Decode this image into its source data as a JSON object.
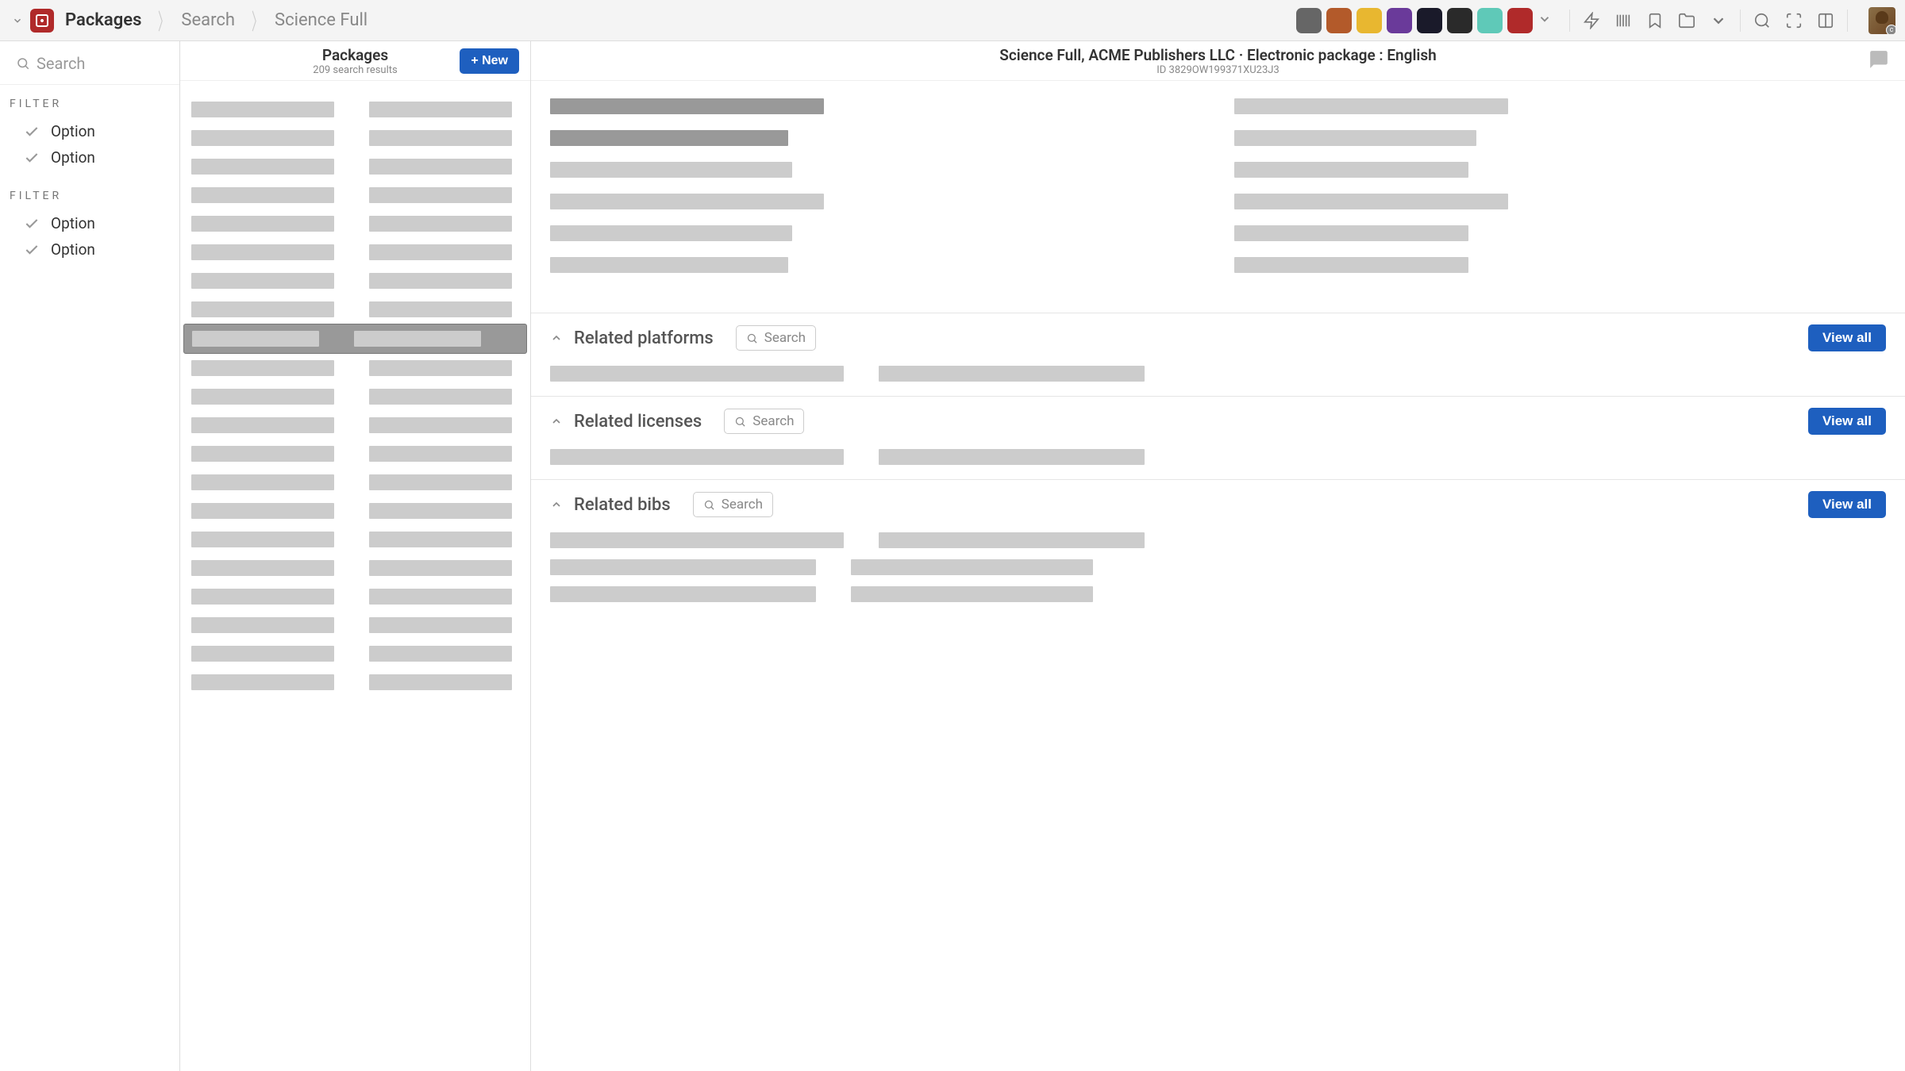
{
  "breadcrumbs": {
    "app_name": "Packages",
    "items": [
      "Search",
      "Science Full"
    ]
  },
  "top_tiles": [
    {
      "bg": "#666"
    },
    {
      "bg": "#b35a2a"
    },
    {
      "bg": "#e8b730"
    },
    {
      "bg": "#6a3a9a"
    },
    {
      "bg": "#1a1a2a"
    },
    {
      "bg": "#2a2a2a"
    },
    {
      "bg": "#5fc9b8"
    },
    {
      "bg": "#b02a2a"
    }
  ],
  "sidebar": {
    "search_placeholder": "Search",
    "filter_groups": [
      {
        "label": "FILTER",
        "options": [
          "Option",
          "Option"
        ]
      },
      {
        "label": "FILTER",
        "options": [
          "Option",
          "Option"
        ]
      }
    ]
  },
  "middle": {
    "title": "Packages",
    "subtitle": "209 search results",
    "new_button": "+ New",
    "selected_index": 8,
    "row_count": 21
  },
  "detail": {
    "title": "Science Full, ACME Publishers LLC · Electronic package : English",
    "subtitle": "ID 3829OW199371XU23J3",
    "sections": [
      {
        "title": "Related platforms",
        "search": "Search",
        "view_all": "View all",
        "rows": 1
      },
      {
        "title": "Related licenses",
        "search": "Search",
        "view_all": "View all",
        "rows": 1
      },
      {
        "title": "Related bibs",
        "search": "Search",
        "view_all": "View all",
        "rows": 3
      }
    ]
  }
}
